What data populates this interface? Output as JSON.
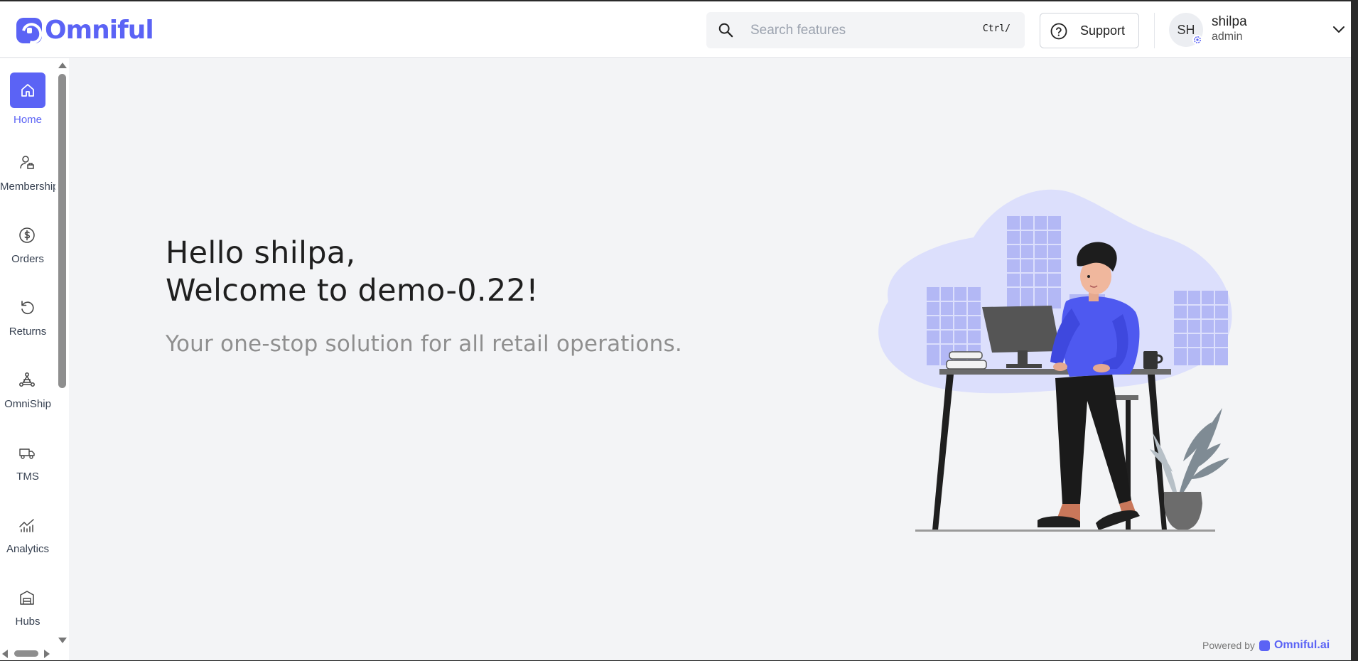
{
  "brand": {
    "name": "Omniful",
    "color": "#5b63f5"
  },
  "header": {
    "search": {
      "placeholder": "Search features",
      "shortcut": "Ctrl/"
    },
    "support_label": "Support",
    "user": {
      "initials": "SH",
      "name": "shilpa",
      "role": "admin"
    }
  },
  "sidebar": {
    "items": [
      {
        "label": "Home",
        "icon": "home-icon",
        "active": true
      },
      {
        "label": "Membership",
        "icon": "membership-icon",
        "active": false
      },
      {
        "label": "Orders",
        "icon": "dollar-icon",
        "active": false
      },
      {
        "label": "Returns",
        "icon": "returns-icon",
        "active": false
      },
      {
        "label": "OmniShip",
        "icon": "omniship-icon",
        "active": false
      },
      {
        "label": "TMS",
        "icon": "truck-icon",
        "active": false
      },
      {
        "label": "Analytics",
        "icon": "analytics-icon",
        "active": false
      },
      {
        "label": "Hubs",
        "icon": "hub-icon",
        "active": false
      }
    ]
  },
  "main": {
    "greeting_line1": "Hello shilpa,",
    "greeting_line2": "Welcome to demo-0.22!",
    "tagline": "Your one-stop solution for all retail operations."
  },
  "footer": {
    "powered_by": "Powered by",
    "brand": "Omniful.ai"
  }
}
